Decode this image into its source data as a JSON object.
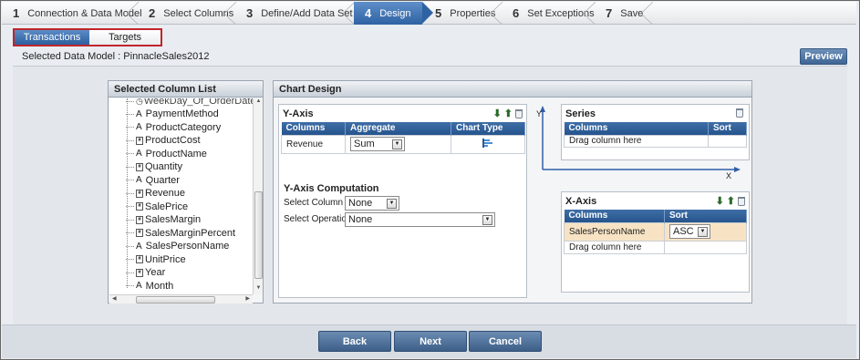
{
  "wizard": {
    "steps": [
      {
        "num": "1",
        "label": "Connection & Data Model"
      },
      {
        "num": "2",
        "label": "Select Columns"
      },
      {
        "num": "3",
        "label": "Define/Add Data Set"
      },
      {
        "num": "4",
        "label": "Design"
      },
      {
        "num": "5",
        "label": "Properties"
      },
      {
        "num": "6",
        "label": "Set Exceptions"
      },
      {
        "num": "7",
        "label": "Save"
      }
    ],
    "active_step": "4"
  },
  "subtabs": {
    "transactions": "Transactions",
    "targets": "Targets"
  },
  "selected_model": "Selected Data Model : PinnacleSales2012",
  "preview_label": "Preview",
  "column_list": {
    "title": "Selected Column List",
    "partial_top_item": "WeekDay_Of_OrderDate",
    "items": [
      {
        "type": "A",
        "name": "PaymentMethod"
      },
      {
        "type": "A",
        "name": "ProductCategory"
      },
      {
        "type": "#",
        "name": "ProductCost"
      },
      {
        "type": "A",
        "name": "ProductName"
      },
      {
        "type": "#",
        "name": "Quantity"
      },
      {
        "type": "A",
        "name": "Quarter"
      },
      {
        "type": "#",
        "name": "Revenue"
      },
      {
        "type": "#",
        "name": "SalePrice"
      },
      {
        "type": "#",
        "name": "SalesMargin"
      },
      {
        "type": "#",
        "name": "SalesMarginPercent"
      },
      {
        "type": "A",
        "name": "SalesPersonName"
      },
      {
        "type": "#",
        "name": "UnitPrice"
      },
      {
        "type": "#",
        "name": "Year"
      },
      {
        "type": "A",
        "name": "Month"
      }
    ]
  },
  "chart_design": {
    "title": "Chart Design",
    "y_axis": {
      "title": "Y-Axis",
      "headers": {
        "columns": "Columns",
        "aggregate": "Aggregate",
        "chart_type": "Chart Type"
      },
      "row": {
        "column": "Revenue",
        "aggregate": "Sum"
      }
    },
    "y_axis_computation": {
      "title": "Y-Axis Computation",
      "select_column_label": "Select Column",
      "select_column_value": "None",
      "select_operation_label": "Select Operation",
      "select_operation_value": "None"
    },
    "axis_labels": {
      "y": "Y",
      "x": "X"
    },
    "series": {
      "title": "Series",
      "headers": {
        "columns": "Columns",
        "sort": "Sort"
      },
      "placeholder": "Drag column here"
    },
    "x_axis": {
      "title": "X-Axis",
      "headers": {
        "columns": "Columns",
        "sort": "Sort"
      },
      "row": {
        "column": "SalesPersonName",
        "sort": "ASC"
      },
      "placeholder": "Drag column here"
    }
  },
  "footer": {
    "back": "Back",
    "next": "Next",
    "cancel": "Cancel"
  },
  "colors": {
    "accent": "#2f62a3",
    "highlight_row": "#f7e3c4",
    "subtab_border": "#c0262a"
  }
}
